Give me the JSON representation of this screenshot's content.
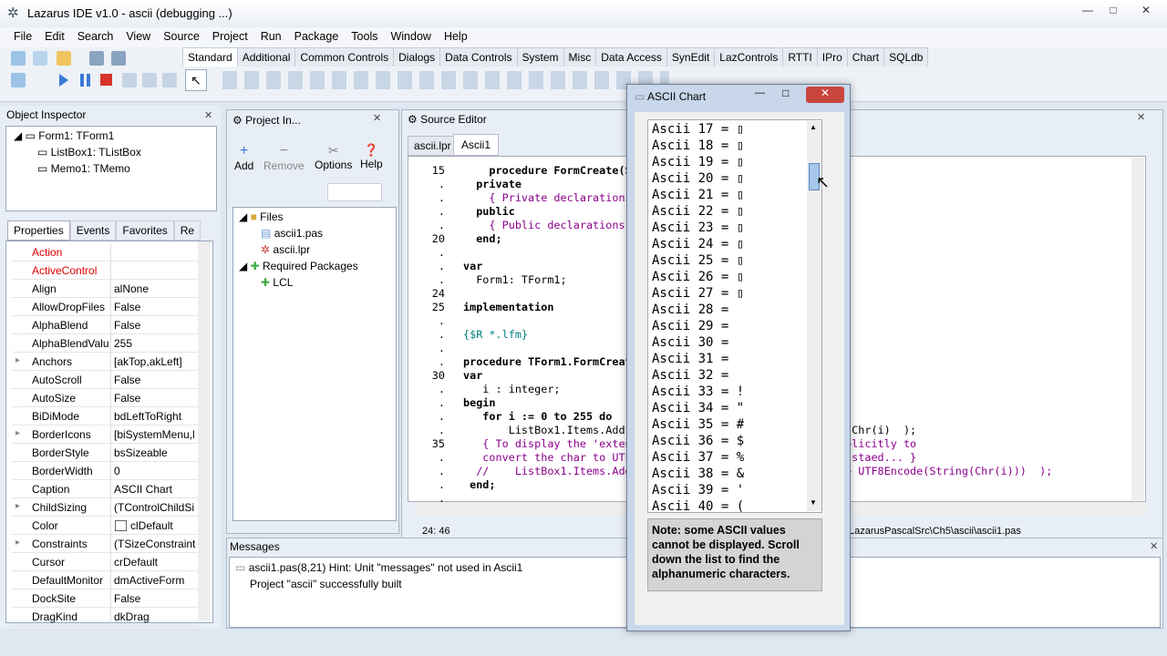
{
  "window": {
    "title": "Lazarus IDE v1.0 - ascii (debugging ...)"
  },
  "menu": [
    "File",
    "Edit",
    "Search",
    "View",
    "Source",
    "Project",
    "Run",
    "Package",
    "Tools",
    "Window",
    "Help"
  ],
  "component_tabs": [
    "Standard",
    "Additional",
    "Common Controls",
    "Dialogs",
    "Data Controls",
    "System",
    "Misc",
    "Data Access",
    "SynEdit",
    "LazControls",
    "RTTI",
    "IPro",
    "Chart",
    "SQLdb"
  ],
  "object_inspector": {
    "title": "Object Inspector",
    "tree": [
      "Form1: TForm1",
      "ListBox1: TListBox",
      "Memo1: TMemo"
    ],
    "tabs": [
      "Properties",
      "Events",
      "Favorites",
      "Re"
    ],
    "properties": [
      {
        "name": "Action",
        "value": ""
      },
      {
        "name": "ActiveControl",
        "value": ""
      },
      {
        "name": "Align",
        "value": "alNone"
      },
      {
        "name": "AllowDropFiles",
        "value": "False"
      },
      {
        "name": "AlphaBlend",
        "value": "False"
      },
      {
        "name": "AlphaBlendValu",
        "value": "255"
      },
      {
        "name": "Anchors",
        "value": "[akTop,akLeft]"
      },
      {
        "name": "AutoScroll",
        "value": "False"
      },
      {
        "name": "AutoSize",
        "value": "False"
      },
      {
        "name": "BiDiMode",
        "value": "bdLeftToRight"
      },
      {
        "name": "BorderIcons",
        "value": "[biSystemMenu,l"
      },
      {
        "name": "BorderStyle",
        "value": "bsSizeable"
      },
      {
        "name": "BorderWidth",
        "value": "0"
      },
      {
        "name": "Caption",
        "value": "ASCII Chart"
      },
      {
        "name": "ChildSizing",
        "value": "(TControlChildSi"
      },
      {
        "name": "Color",
        "value": "clDefault"
      },
      {
        "name": "Constraints",
        "value": "(TSizeConstraint"
      },
      {
        "name": "Cursor",
        "value": "crDefault"
      },
      {
        "name": "DefaultMonitor",
        "value": "dmActiveForm"
      },
      {
        "name": "DockSite",
        "value": "False"
      },
      {
        "name": "DragKind",
        "value": "dkDrag"
      }
    ]
  },
  "project_inspector": {
    "title": "Project In...",
    "buttons": [
      "Add",
      "Remove",
      "Options",
      "Help"
    ],
    "tree": [
      "Files",
      "ascii1.pas",
      "ascii.lpr",
      "Required Packages",
      "LCL"
    ]
  },
  "source_editor": {
    "title": "Source Editor",
    "tabs": [
      "ascii.lpr",
      "Ascii1"
    ],
    "line_numbers": [
      "15",
      ".",
      ".",
      ".",
      ".",
      "20",
      ".",
      ".",
      ".",
      "24",
      "25",
      ".",
      ".",
      ".",
      ".",
      "30",
      ".",
      ".",
      ".",
      ".",
      "35",
      ".",
      ".",
      ".",
      "."
    ],
    "lines": [
      "    procedure FormCreate(Sender: TObject);",
      "  private",
      "    { Private declarations }",
      "  public",
      "    { Public declarations }",
      "  end;",
      "",
      "var",
      "  Form1: TForm1;",
      "",
      "implementation",
      "",
      "{$R *.lfm}",
      "",
      "procedure TForm1.FormCreate(Sender: TObject);",
      "var",
      "   i : integer;",
      "begin",
      "   for i := 0 to 255 do",
      "       ListBox1.Items.Add( 'Ascii ' + IntToStr(i) + ' = ' + Chr(i)  );",
      "   { To display the 'extended' ascii characters you need explicitly to",
      "   convert the char to UTF8 before adding it. So try this instaed... }",
      "  //    ListBox1.Items.Add( 'Ascii ' + IntToStr(i) + ' = ' + UTF8Encode(String(Chr(i)))  );",
      " end;",
      ""
    ],
    "status_pos": "24: 46",
    "status_file": "LazarusPascalSrc\\Ch5\\ascii\\ascii1.pas"
  },
  "messages": {
    "title": "Messages",
    "items": [
      "ascii1.pas(8,21) Hint: Unit \"messages\" not used in Ascii1",
      "Project \"ascii\" successfully built"
    ]
  },
  "ascii_dialog": {
    "title": "ASCII Chart",
    "items": [
      "Ascii 17 = ▯",
      "Ascii 18 = ▯",
      "Ascii 19 = ▯",
      "Ascii 20 = ▯",
      "Ascii 21 = ▯",
      "Ascii 22 = ▯",
      "Ascii 23 = ▯",
      "Ascii 24 = ▯",
      "Ascii 25 = ▯",
      "Ascii 26 = ▯",
      "Ascii 27 = ▯",
      "Ascii 28 =",
      "Ascii 29 =",
      "Ascii 30 =",
      "Ascii 31 =",
      "Ascii 32 =",
      "Ascii 33 = !",
      "Ascii 34 = \"",
      "Ascii 35 = #",
      "Ascii 36 = $",
      "Ascii 37 = %",
      "Ascii 38 = &",
      "Ascii 39 = '",
      "Ascii 40 = ("
    ],
    "note": "Note: some ASCII values cannot be displayed. Scroll down the list to find the alphanumeric characters."
  }
}
